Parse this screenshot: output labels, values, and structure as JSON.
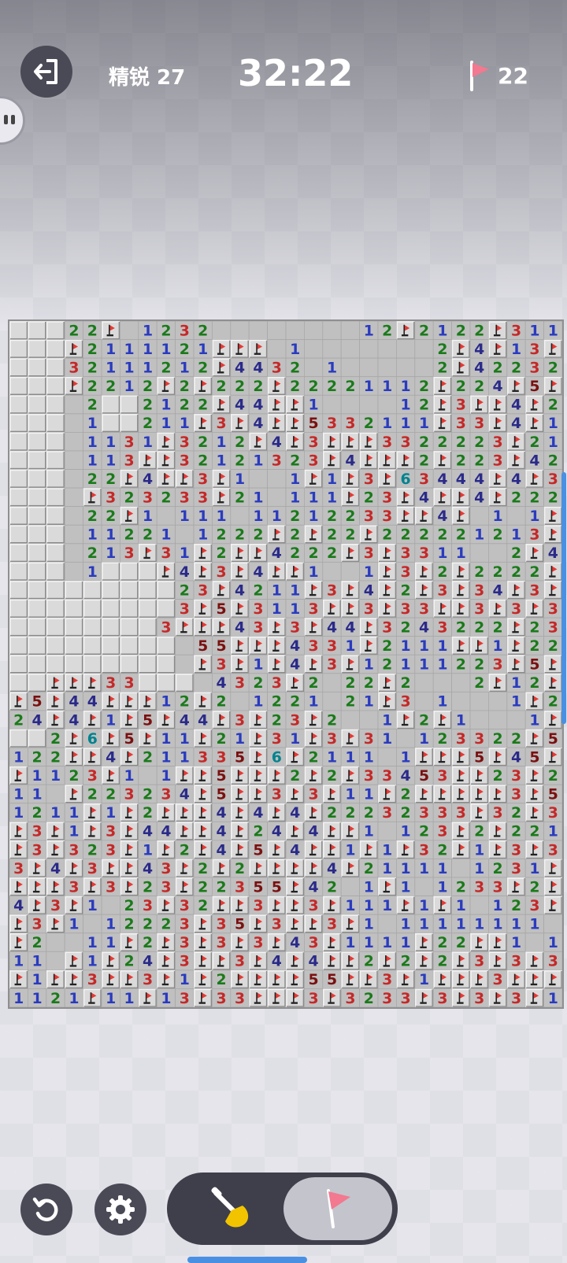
{
  "header": {
    "difficulty": "精锐 27",
    "timer": "32:22",
    "flags": "22"
  },
  "board": {
    "cols": 30,
    "visible_rows": 37,
    "rows": [
      "UUU22F.1232........12F2122F311.1F",
      "UUUF2111121FFF.1.......2F4F13F5F1.11",
      "UUU32111212F4432.1.....2F42232FF21",
      "UUUF2212F2F222F22221112F224F5F21.11",
      "UUU.2UU2122F44FF1....12F3FF4F2F111F",
      "UUU.1UU211F3F4FF5332111F33F4F1F122",
      "UUU.1131F3212F4F3FFF3322223F21F1F",
      "UUU.113FF32121323F4FFF2F223F422F34",
      "UUU.22F4FF3F1..1F1F3F63444F4F3F2FF",
      "UUU.F323233F21.111F23F4FF4F2223F33",
      "UUU.22F1.111.11212233FF4F.1.1F1",
      "UUU.11221.1222F2F22F222221213F22",
      "UUU.213F31F2FF4222F3F3311..2F4F22",
      "UUU.1UUUF4F3F4FF1..1F3F2F2222F3FF3",
      "UUUUUUUUU23F4211F3F4F2F3F34F3F433F",
      "UUUUUUUUU3F5F3113FF3F33FF3F3F32F2F33",
      "UUUUUUUU3FFF43F3F44F3243222F233F5",
      "UUUUUUUUU.55FFF4331F2111FF1F22F35FF",
      "UUUUUUUUU.F3F1F4F3F12111223F5FFF5",
      "UUFFF33UUU.4323F2.22F2...2F12F5F3",
      "F5F44FFF12F2.1221.21F3.1...1F224FF31",
      "24F4F1F5F44F3F23F2..1F2F1...1F234F31",
      "UU2F6F5F11F21F31F3F31.123322F5F1F42",
      "122FF4F211335F6F2111.1FFF5F45FF11",
      "F1123F1.1FF5FFF2F2F33453FF23F23F4",
      "11.F223234F5FF3F3F11F2FFFFF3F53F1FF",
      "1211F1F2FFF4F4F4F22232333F32F3F2F1F1214",
      "F3F1F3F44FF4F24F4FF1.123F2F2211.2",
      "F3F323F1F2F4F5F4FF1F1F32F1F3F3F22F2F14",
      "3F4F3FF43F2F2FFFF4F21111.1231F23F22F",
      "FFF3F3F23F22355F42.1F1.1233F2F131F",
      "4F3F1.23F32FF3FF3F111F1F1.123F21.2F",
      "F3F1.12223F35F3FF3F1.11111111.22F2.12",
      "F2..11F2F3F3F3F43F1111F22FF1.1F1.111",
      "11.F1F24F3FF3F4F4FF2F2F2F3F3F35F4323F2F1.1F3",
      "F1FF3FF3F1F2FFFF55FF3F1FFF3FFF21.13F",
      "1121F11F13F33FFF3F3233F3F3F3F1.2F2F"
    ]
  }
}
